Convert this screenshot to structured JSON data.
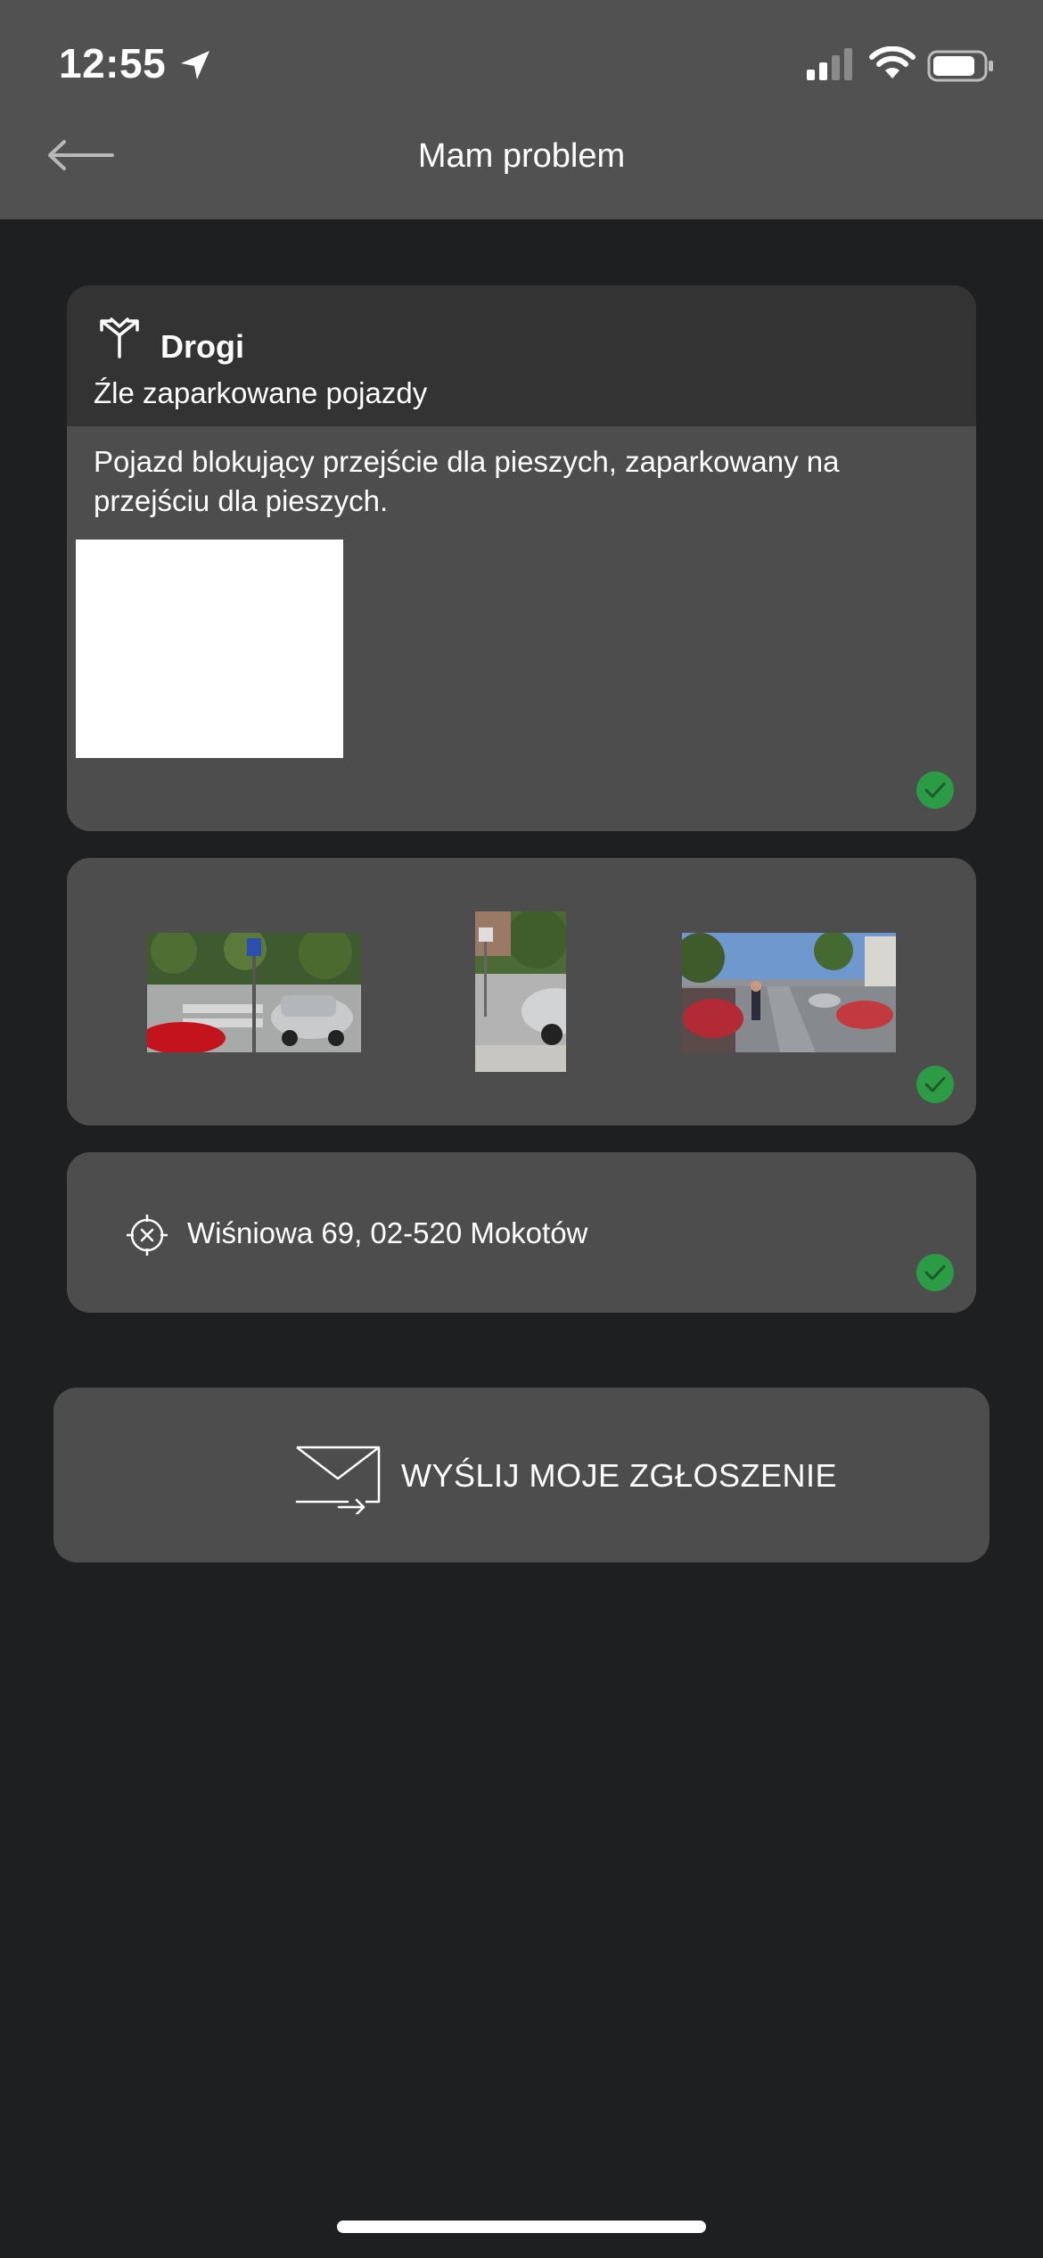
{
  "status_bar": {
    "time": "12:55"
  },
  "header": {
    "title": "Mam problem"
  },
  "category_card": {
    "category": "Drogi",
    "subcategory": "Źle zaparkowane pojazdy",
    "description": "Pojazd blokujący przejście dla pieszych, zaparkowany na przejściu dla pieszych."
  },
  "location": {
    "address": "Wiśniowa 69, 02-520 Mokotów"
  },
  "send_button": {
    "label": "WYŚLIJ MOJE ZGŁOSZENIE"
  },
  "colors": {
    "header_bg": "#515151",
    "page_bg": "#1e1f21",
    "card_bg": "#4d4d4d",
    "check_green": "#2c9b45"
  }
}
